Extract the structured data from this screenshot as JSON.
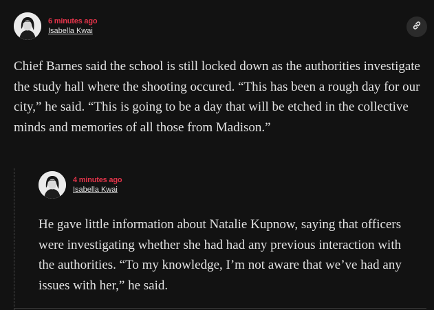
{
  "post": {
    "timestamp": "6 minutes ago",
    "author": "Isabella Kwai",
    "link_icon": "link-icon",
    "text": "Chief Barnes said the school is still locked down as the authorities investigate the study hall where the shooting occured. “This has been a rough day for our city,” he said. “This is going to be a day that will be etched in the collective minds and memories of all those from Madison.”"
  },
  "reply": {
    "timestamp": "4 minutes ago",
    "author": "Isabella Kwai",
    "text": "He gave little information about Natalie Kupnow, saying that officers were investigating whether she had had any previous interaction with the authorities. “To my knowledge, I’m not aware that we’ve had any issues with her,” he said."
  },
  "colors": {
    "background": "#121212",
    "timestamp": "#e3344a",
    "text": "#e2e2e2"
  }
}
